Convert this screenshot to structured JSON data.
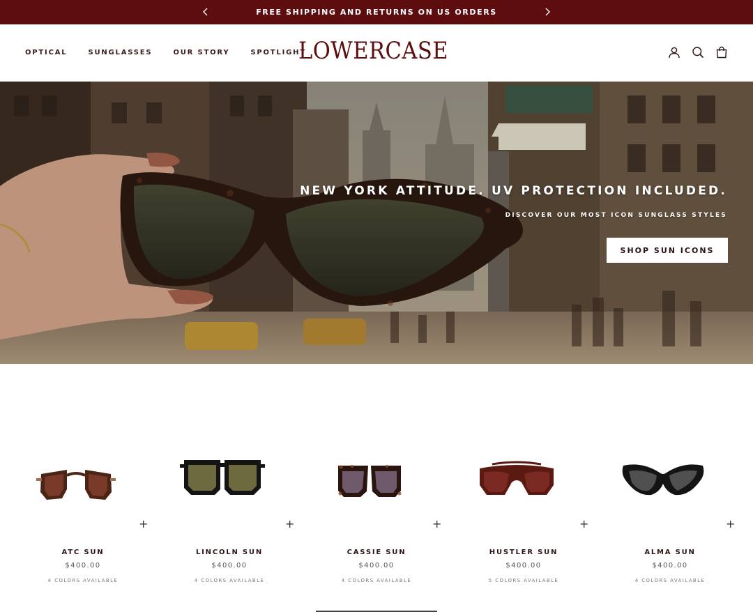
{
  "announcement": {
    "text": "FREE SHIPPING AND RETURNS ON US ORDERS",
    "prev_icon": "chevron-left-icon",
    "next_icon": "chevron-right-icon"
  },
  "header": {
    "nav": [
      "OPTICAL",
      "SUNGLASSES",
      "OUR STORY",
      "SPOTLIGHT"
    ],
    "logo": "LOWERCASE",
    "icons": [
      "account-icon",
      "search-icon",
      "bag-icon"
    ]
  },
  "hero": {
    "headline": "NEW YORK ATTITUDE. UV PROTECTION INCLUDED.",
    "subheadline": "DISCOVER OUR MOST ICON SUNGLASS STYLES",
    "cta": "SHOP SUN ICONS"
  },
  "products": [
    {
      "name": "ATC SUN",
      "price": "$400.00",
      "colors": "4 COLORS AVAILABLE"
    },
    {
      "name": "LINCOLN SUN",
      "price": "$400.00",
      "colors": "4 COLORS AVAILABLE"
    },
    {
      "name": "CASSIE SUN",
      "price": "$400.00",
      "colors": "4 COLORS AVAILABLE"
    },
    {
      "name": "HUSTLER SUN",
      "price": "$400.00",
      "colors": "5 COLORS AVAILABLE"
    },
    {
      "name": "ALMA SUN",
      "price": "$400.00",
      "colors": "4 COLORS AVAILABLE"
    }
  ],
  "product_plus_label": "+",
  "colors": {
    "brand": "#5e0d0f"
  }
}
